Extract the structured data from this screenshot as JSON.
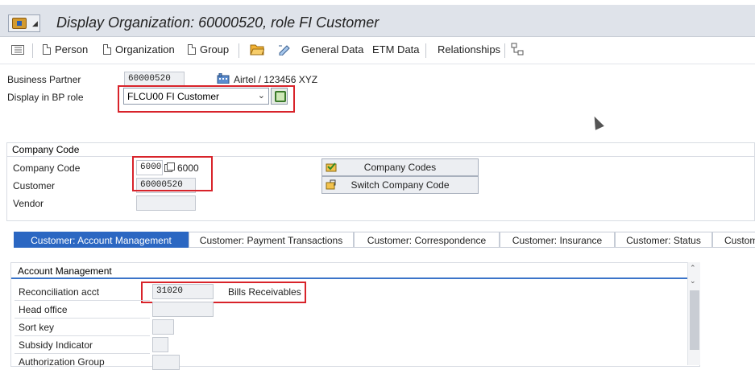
{
  "window": {
    "title": "Display Organization: 60000520, role FI Customer"
  },
  "toolbar": {
    "person": "Person",
    "organization": "Organization",
    "group": "Group",
    "general_data": "General Data",
    "etm_data": "ETM Data",
    "relationships": "Relationships"
  },
  "header": {
    "business_partner_label": "Business Partner",
    "business_partner_value": "60000520",
    "bp_description": "Airtel / 123456 XYZ",
    "display_role_label": "Display in BP role",
    "display_role_value": "FLCU00 FI Customer"
  },
  "company_code_section": {
    "title": "Company Code",
    "company_code_label": "Company Code",
    "company_code_value": "6000",
    "company_code_text": "6000",
    "customer_label": "Customer",
    "customer_value": "60000520",
    "vendor_label": "Vendor",
    "vendor_value": "",
    "company_codes_button": "Company Codes",
    "switch_company_code_button": "Switch Company Code"
  },
  "tabs": [
    {
      "label": "Customer: Account Management",
      "active": true
    },
    {
      "label": "Customer: Payment Transactions",
      "active": false
    },
    {
      "label": "Customer: Correspondence",
      "active": false
    },
    {
      "label": "Customer: Insurance",
      "active": false
    },
    {
      "label": "Customer: Status",
      "active": false
    },
    {
      "label": "Custom",
      "active": false
    }
  ],
  "account_management": {
    "title": "Account Management",
    "reconciliation_label": "Reconciliation acct",
    "reconciliation_value": "31020",
    "reconciliation_text": "Bills Receivables",
    "head_office_label": "Head office",
    "sort_key_label": "Sort key",
    "subsidy_indicator_label": "Subsidy Indicator",
    "authorization_group_label": "Authorization Group"
  },
  "colors": {
    "active_tab": "#2b67c2",
    "highlight_box": "#d8232a"
  }
}
